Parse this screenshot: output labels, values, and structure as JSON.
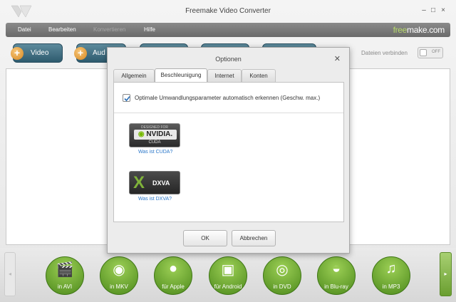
{
  "window": {
    "title": "Freemake Video Converter",
    "controls": [
      "–",
      "□",
      "×"
    ]
  },
  "menu": {
    "items": [
      {
        "label": "Datei",
        "enabled": true
      },
      {
        "label": "Bearbeiten",
        "enabled": true
      },
      {
        "label": "Konvertieren",
        "enabled": false
      },
      {
        "label": "Hilfe",
        "enabled": true
      }
    ],
    "brand_prefix": "free",
    "brand_suffix": "make.com"
  },
  "toolbar": {
    "video_label": "Video",
    "audio_label": "Aud",
    "join_label": "Dateien verbinden",
    "toggle_state": "OFF"
  },
  "formats": [
    {
      "label": "in AVI",
      "icon": "clapperboard-icon"
    },
    {
      "label": "in MKV",
      "icon": "matryoshka-icon"
    },
    {
      "label": "für Apple",
      "icon": "apple-icon"
    },
    {
      "label": "für Android",
      "icon": "android-icon"
    },
    {
      "label": "in DVD",
      "icon": "dvd-icon"
    },
    {
      "label": "in Blu-ray",
      "icon": "blu-ray-icon"
    },
    {
      "label": "in MP3",
      "icon": "headphones-icon"
    }
  ],
  "dialog": {
    "title": "Optionen",
    "tabs": [
      {
        "label": "Allgemein",
        "active": false
      },
      {
        "label": "Beschleunigung",
        "active": true
      },
      {
        "label": "Internet",
        "active": false
      },
      {
        "label": "Konten",
        "active": false
      }
    ],
    "auto_detect": {
      "checked": true,
      "label": "Optimale Umwandlungsparameter automatisch erkennen (Geschw. max.)"
    },
    "nvidia": {
      "badge_top": "DESIGNED FOR",
      "badge_brand": "NVIDIA.",
      "badge_sub": "CUDA",
      "link": "Was ist CUDA?"
    },
    "dxva": {
      "badge_mark": "X",
      "badge_text": "DXVA",
      "link": "Was ist DXVA?"
    },
    "ok_label": "OK",
    "cancel_label": "Abbrechen"
  },
  "colors": {
    "accent_green": "#6a9e30",
    "toolbar_blue": "#2e5b6e",
    "link_blue": "#2a77c9",
    "nvidia_green": "#76b900"
  }
}
